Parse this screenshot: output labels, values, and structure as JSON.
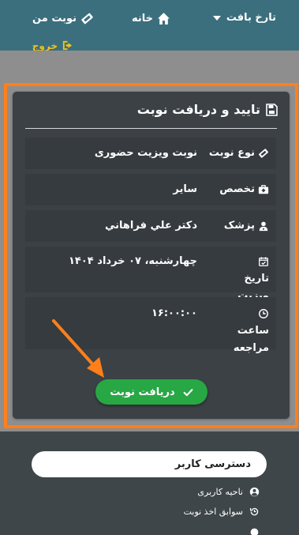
{
  "nav": {
    "clinic_label": "تارخ بافت",
    "home_label": "خانه",
    "my_appointments_label": "نوبت من",
    "logout_label": "خروج"
  },
  "card": {
    "title": "تایید و دریافت نوبت",
    "rows": [
      {
        "label": "نوع نوبت",
        "value": "نوبت ویزیت حضوری",
        "icon": "ticket-icon"
      },
      {
        "label": "تخصص",
        "value": "سایر",
        "icon": "medkit-icon"
      },
      {
        "label": "پزشک",
        "value": "دکتر علي فراهاني",
        "icon": "user-md-icon"
      },
      {
        "label": "تاریخ ویزیت",
        "value": "چهارشنبه، ۰۷ خرداد ۱۴۰۴",
        "icon": "calendar-check-icon"
      },
      {
        "label": "ساعت مراجعه",
        "value": "۱۶:۰۰:۰۰",
        "icon": "clock-icon"
      }
    ],
    "submit_label": "دریافت نوبت"
  },
  "user_access": {
    "title": "دسترسی کاربر",
    "links": [
      {
        "label": "ناحیه کاربری",
        "icon": "user-circle-icon"
      },
      {
        "label": "سوابق اخذ نوبت",
        "icon": "history-icon"
      }
    ]
  },
  "colors": {
    "nav_bg": "#3b6f7d",
    "card_bg": "#3b4145",
    "highlight": "#ff7f1a",
    "submit": "#28a745",
    "logout": "#f2c31a"
  }
}
